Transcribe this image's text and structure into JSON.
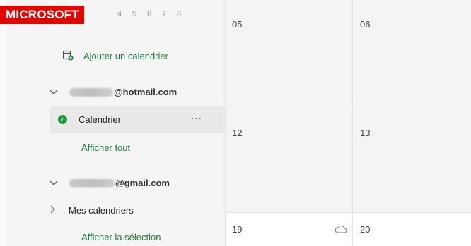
{
  "badge": "MICROSOFT",
  "mini_calendar_days": [
    "4",
    "5",
    "6",
    "7",
    "8"
  ],
  "sidebar": {
    "add_calendar": "Ajouter un calendrier",
    "account1": {
      "email_suffix": "@hotmail.com"
    },
    "calendar_item": {
      "label": "Calendrier",
      "more": "···"
    },
    "show_all": "Afficher tout",
    "account2": {
      "email_suffix": "@gmail.com"
    },
    "my_calendars": "Mes calendriers",
    "show_selection": "Afficher la sélection"
  },
  "grid": {
    "dates": [
      "05",
      "06",
      "12",
      "13",
      "19",
      "20"
    ]
  },
  "colors": {
    "accent_green": "#1a7f37",
    "badge_red": "#e10600"
  }
}
